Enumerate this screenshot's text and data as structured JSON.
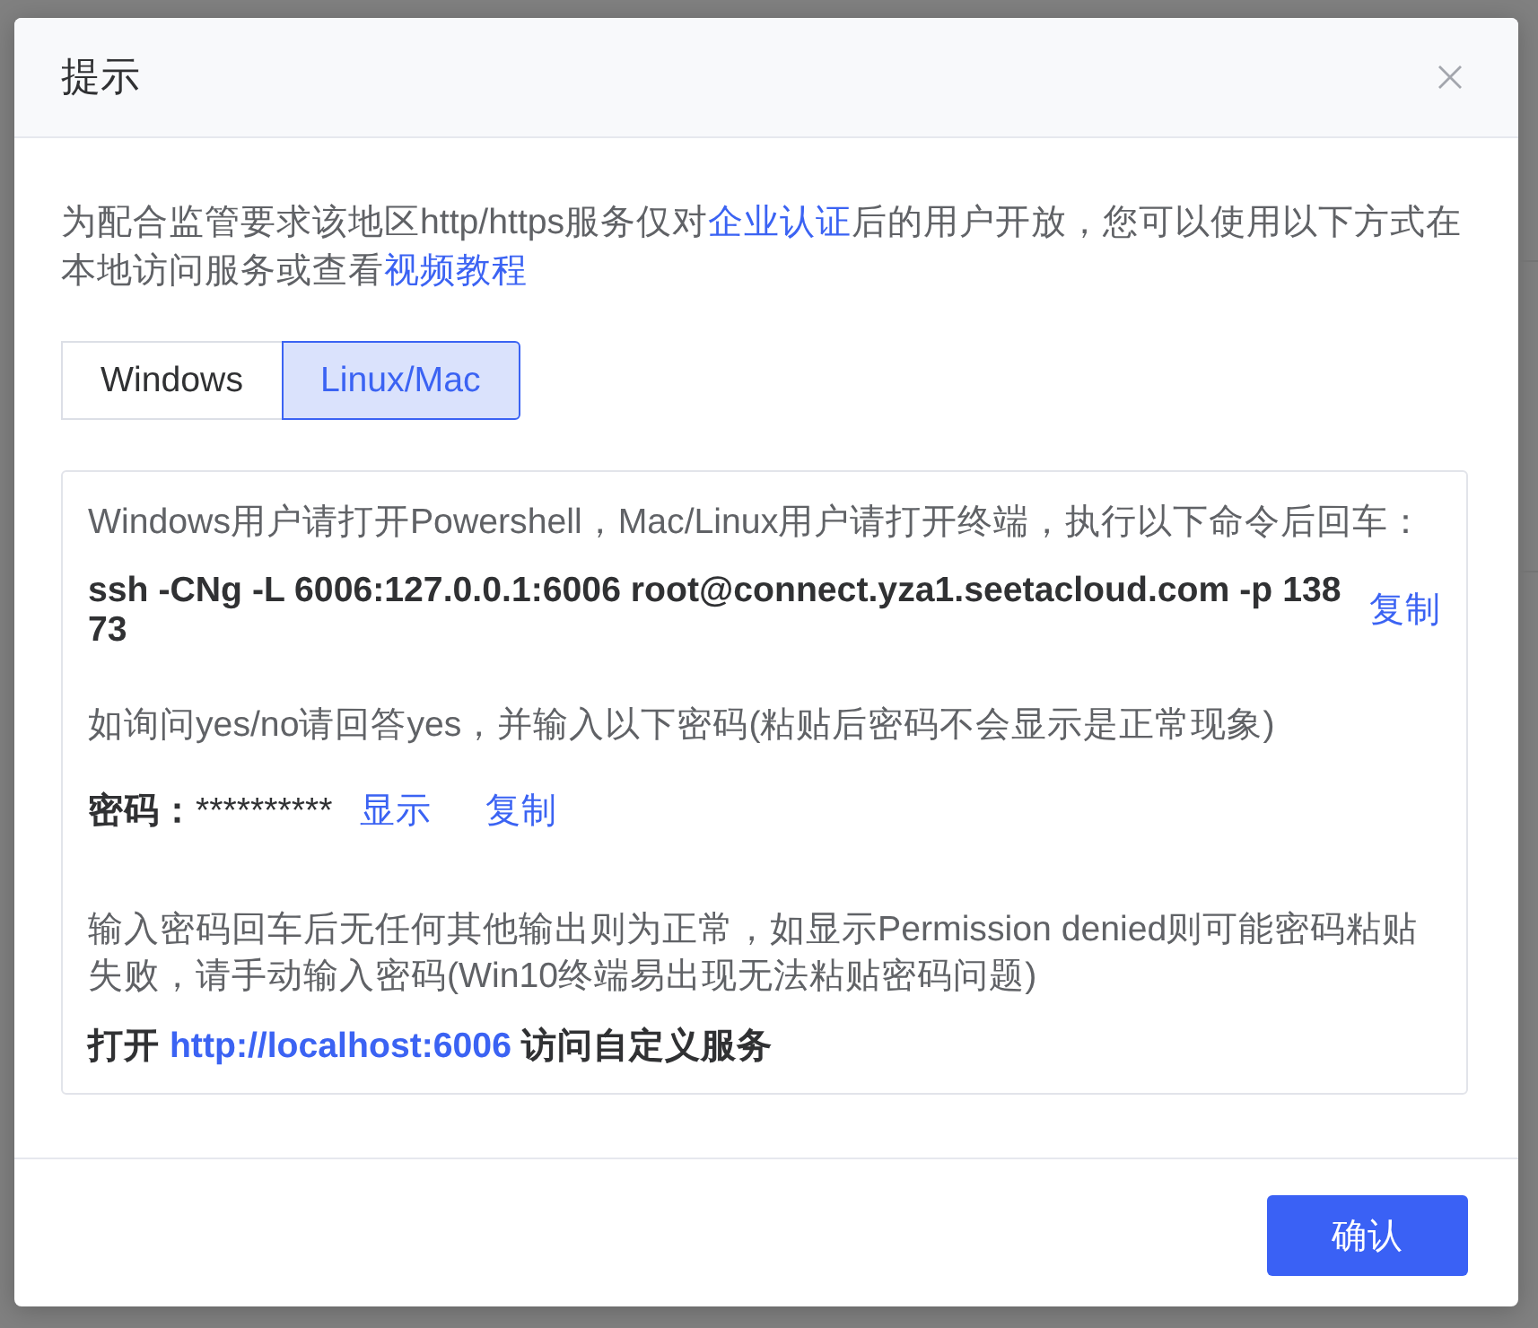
{
  "dialog": {
    "title": "提示"
  },
  "notice": [
    {
      "kind": "text",
      "text": "为配合监管要求该地区http/https服务仅对"
    },
    {
      "kind": "link",
      "text": "企业认证"
    },
    {
      "kind": "text",
      "text": "后的用户开放，您可以使用以下方式在本地访问服务或查看"
    },
    {
      "kind": "link",
      "text": "视频教程"
    }
  ],
  "tabs": [
    {
      "label": "Windows",
      "selected": false
    },
    {
      "label": "Linux/Mac",
      "selected": true
    }
  ],
  "guide": {
    "intro": "Windows用户请打开Powershell，Mac/Linux用户请打开终端，执行以下命令后回车：",
    "command": "ssh -CNg -L 6006:127.0.0.1:6006 root@connect.yza1.seetacloud.com -p 13873",
    "command_copy": "复制",
    "password_hint": "如询问yes/no请回答yes，并输入以下密码(粘贴后密码不会显示是正常现象)",
    "password": {
      "label": "密码：",
      "value": "**********",
      "show": "显示",
      "copy": "复制"
    },
    "note": "输入密码回车后无任何其他输出则为正常，如显示Permission denied则可能密码粘贴失败，请手动输入密码(Win10终端易出现无法粘贴密码问题)",
    "open_service": [
      {
        "kind": "text",
        "text": "打开 "
      },
      {
        "kind": "link",
        "text": "http://localhost:6006"
      },
      {
        "kind": "text",
        "text": " 访问自定义服务"
      }
    ]
  },
  "footer": {
    "confirm_button": "确认"
  }
}
